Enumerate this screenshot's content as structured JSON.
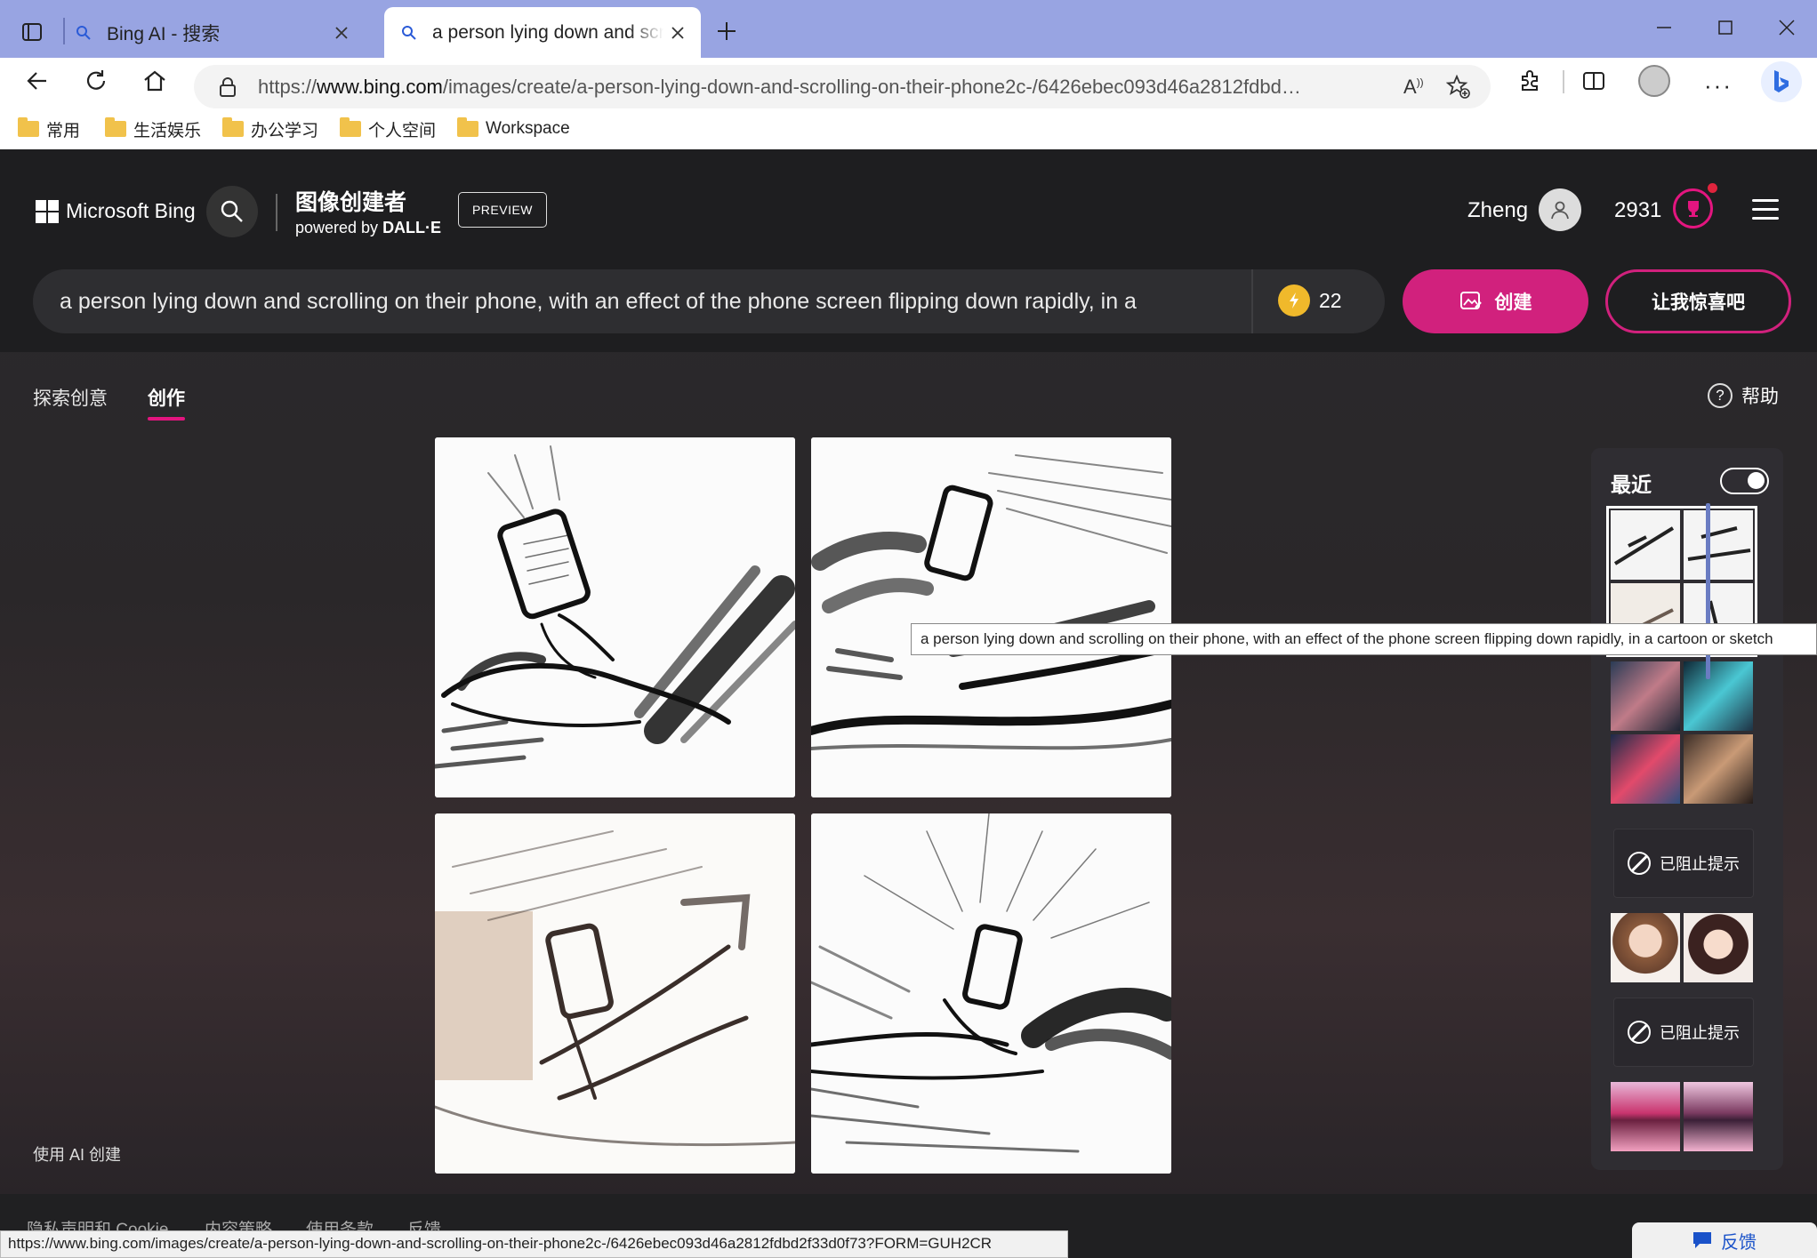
{
  "browser": {
    "tabs": [
      {
        "title": "Bing AI - 搜索",
        "active": false
      },
      {
        "title": "a person lying down and scrolling",
        "active": true
      }
    ],
    "url_prefix": "https://",
    "url_domain": "www.bing.com",
    "url_path": "/images/create/a-person-lying-down-and-scrolling-on-their-phone2c-/6426ebec093d46a2812fdbd2f33d0f73?FO...",
    "bookmarks": [
      "常用",
      "生活娱乐",
      "办公学习",
      "个人空间",
      "Workspace"
    ]
  },
  "header": {
    "logo_text": "Microsoft Bing",
    "title": "图像创建者",
    "subtitle_prefix": "powered by ",
    "subtitle_brand": "DALL·E",
    "preview_badge": "PREVIEW",
    "user_name": "Zheng",
    "points": "2931"
  },
  "prompt": {
    "text": "a person lying down and scrolling on their phone, with an effect of the phone screen flipping down rapidly, in a",
    "boosts": "22",
    "create_label": "创建",
    "surprise_label": "让我惊喜吧"
  },
  "nav": {
    "explore": "探索创意",
    "create": "创作",
    "help": "帮助"
  },
  "sidebar": {
    "title": "最近",
    "blocked_label": "已阻止提示"
  },
  "tooltip": "a person lying down and scrolling on their phone, with an effect of the phone screen flipping down rapidly, in a cartoon or sketch",
  "footer": {
    "ai_note": "使用 AI 创建",
    "links": [
      "隐私声明和 Cookie",
      "内容策略",
      "使用条款",
      "反馈"
    ]
  },
  "status_url": "https://www.bing.com/images/create/a-person-lying-down-and-scrolling-on-their-phone2c-/6426ebec093d46a2812fdbd2f33d0f73?FORM=GUH2CR",
  "feedback_label": "反馈"
}
